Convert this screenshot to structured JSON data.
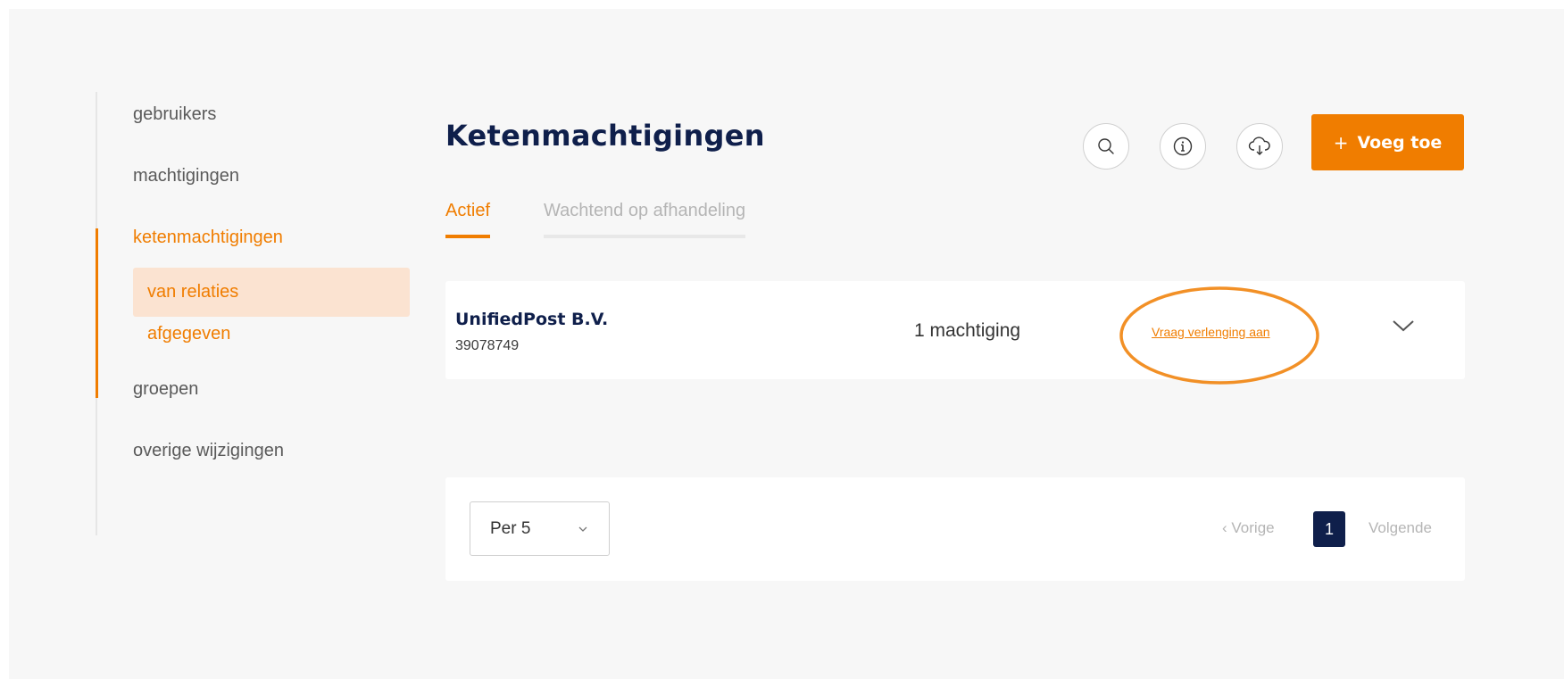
{
  "sidebar": {
    "items": [
      {
        "label": "gebruikers"
      },
      {
        "label": "machtigingen"
      },
      {
        "label": "ketenmachtigingen",
        "active": true
      },
      {
        "label": "groepen"
      },
      {
        "label": "overige wijzigingen"
      }
    ],
    "subitems": [
      {
        "label": "van relaties",
        "selected": true
      },
      {
        "label": "afgegeven"
      }
    ]
  },
  "header": {
    "title": "Ketenmachtigingen",
    "add_label": "Voeg toe",
    "add_icon": "plus",
    "icons": [
      "search-icon",
      "info-icon",
      "cloud-download-icon"
    ]
  },
  "tabs": [
    {
      "label": "Actief",
      "active": true
    },
    {
      "label": "Wachtend op afhandeling",
      "active": false
    }
  ],
  "relations": [
    {
      "name": "UnifiedPost B.V.",
      "number": "39078749",
      "count": "1 machtiging",
      "action": "Vraag verlenging aan"
    }
  ],
  "pagination": {
    "per_page": "Per 5",
    "prev": "Vorige",
    "current": "1",
    "next": "Volgende"
  },
  "colors": {
    "accent": "#f07d00",
    "navy": "#0f1f4b",
    "background": "#f7f7f7"
  }
}
